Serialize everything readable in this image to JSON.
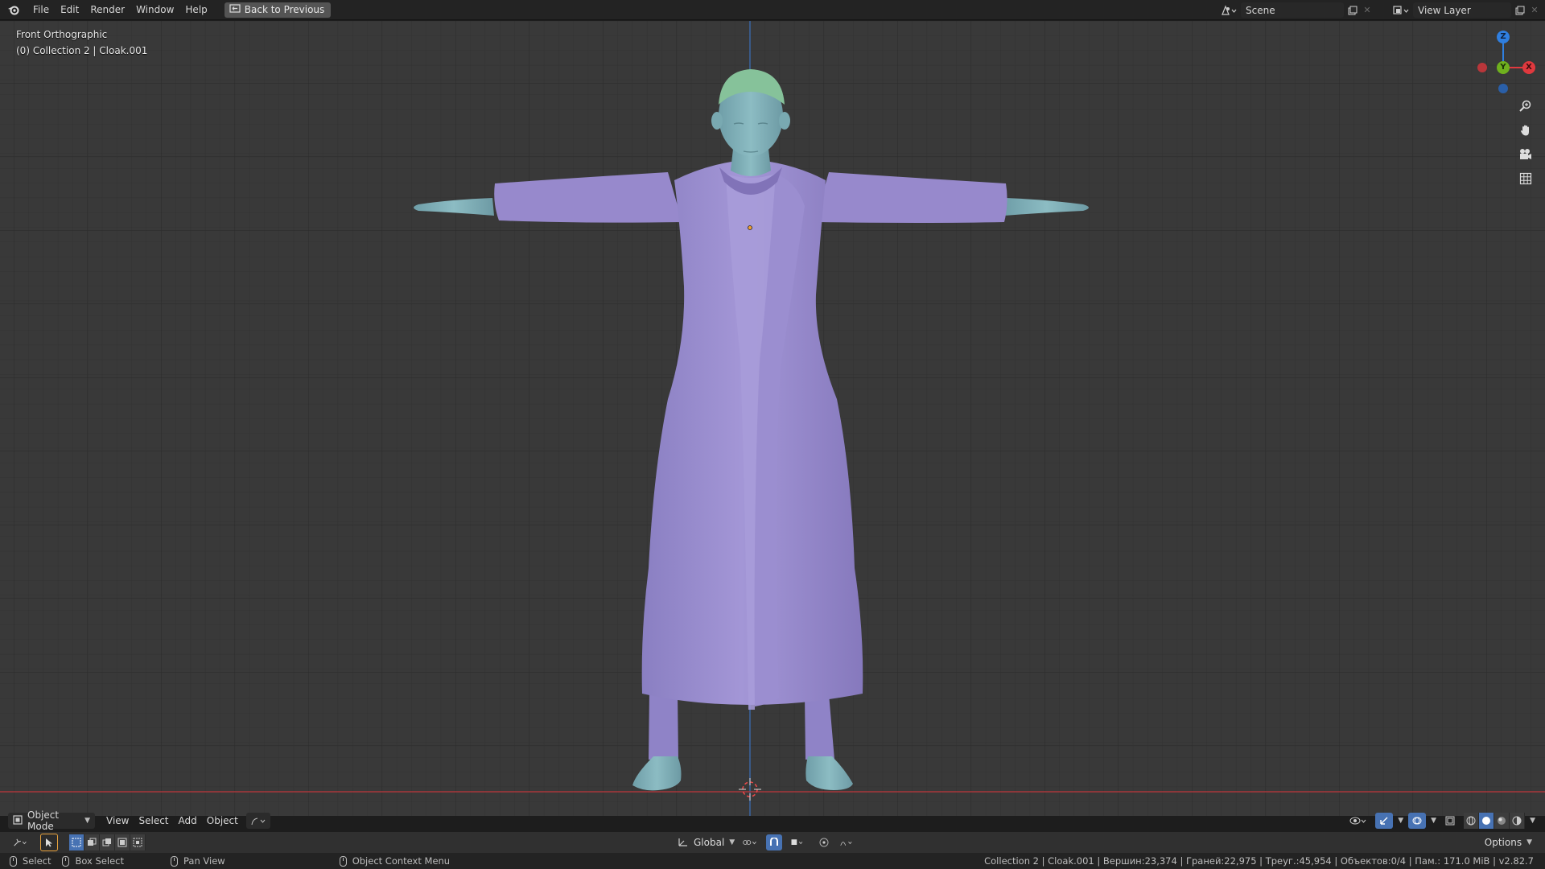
{
  "menu": {
    "items": [
      "File",
      "Edit",
      "Render",
      "Window",
      "Help"
    ],
    "back_button": "Back to Previous"
  },
  "topright": {
    "scene_label": "Scene",
    "view_layer_label": "View Layer"
  },
  "viewport": {
    "view_name": "Front Orthographic",
    "collection_info": "(0) Collection 2 | Cloak.001",
    "gizmo": {
      "z": "Z",
      "y": "Y",
      "x": "X"
    }
  },
  "header": {
    "mode": "Object Mode",
    "menus": [
      "View",
      "Select",
      "Add",
      "Object"
    ],
    "transform_orientation": "Global",
    "options": "Options"
  },
  "statusbar": {
    "select": "Select",
    "box_select": "Box Select",
    "pan_view": "Pan View",
    "context_menu": "Object Context Menu",
    "stats": "Collection 2 | Cloak.001 | Вершин:23,374 | Граней:22,975 | Треуг.:45,954 | Объектов:0/4 | Пам.: 171.0 MiB | v2.82.7"
  },
  "colors": {
    "accent": "#4772b3",
    "axis_x": "#e0393e",
    "axis_y": "#6fb01e",
    "axis_z": "#2f7fe0",
    "robe": "#9c8fd0",
    "skin": "#7fb0b8"
  }
}
